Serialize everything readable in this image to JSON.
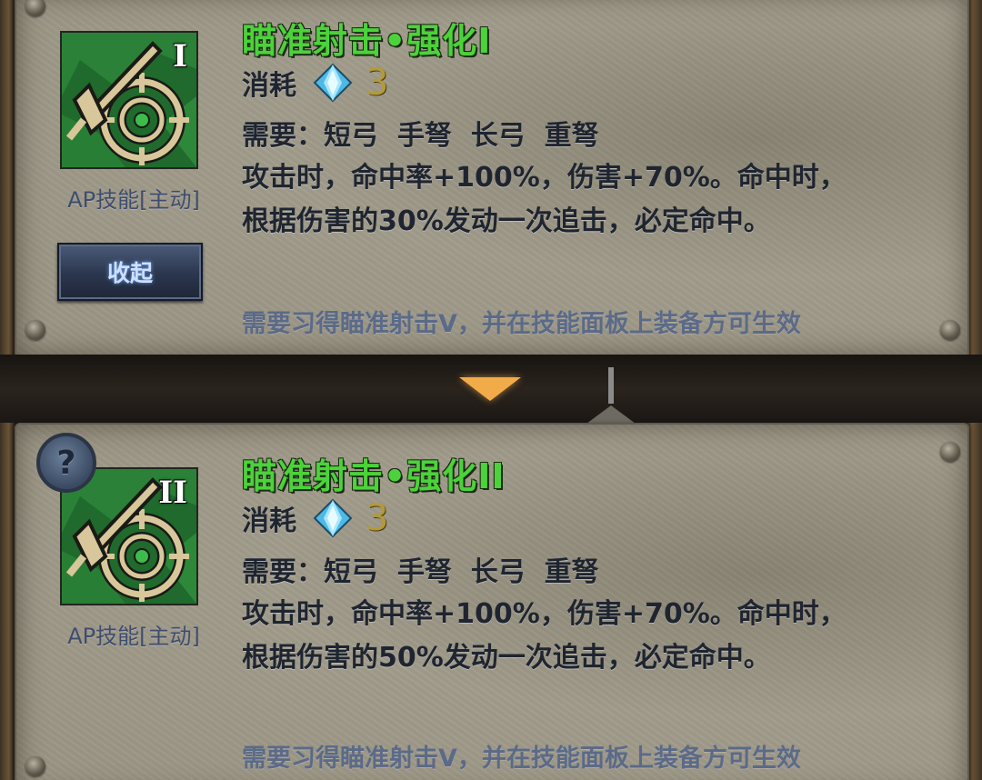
{
  "cards": [
    {
      "title": "瞄准射击•强化I",
      "rank": "I",
      "cost_label": "消耗",
      "cost_icon": "crystal-icon",
      "cost_value": "3",
      "requirement": "需要：短弓  手弩  长弓  重弩",
      "description_lines": [
        "攻击时，命中率+100%，伤害+70%。命中时，",
        "根据伤害的30%发动一次追击，必定命中。"
      ],
      "footnote": "需要习得瞄准射击V，并在技能面板上装备方可生效",
      "icon_caption": "AP技能[主动]",
      "collapse_button": "收起"
    },
    {
      "title": "瞄准射击•强化II",
      "rank": "II",
      "cost_label": "消耗",
      "cost_icon": "crystal-icon",
      "cost_value": "3",
      "requirement": "需要：短弓  手弩  长弓  重弩",
      "description_lines": [
        "攻击时，命中率+100%，伤害+70%。命中时，",
        "根据伤害的50%发动一次追击，必定命中。"
      ],
      "footnote": "需要习得瞄准射击V，并在技能面板上装备方可生效",
      "icon_caption": "AP技能[主动]",
      "help_button": "?"
    }
  ],
  "colors": {
    "title_green": "#4cd23a",
    "cost_gold": "#b39a3a",
    "footnote_blue": "#5b6a88",
    "divider_arrow": "#f1ac49"
  }
}
